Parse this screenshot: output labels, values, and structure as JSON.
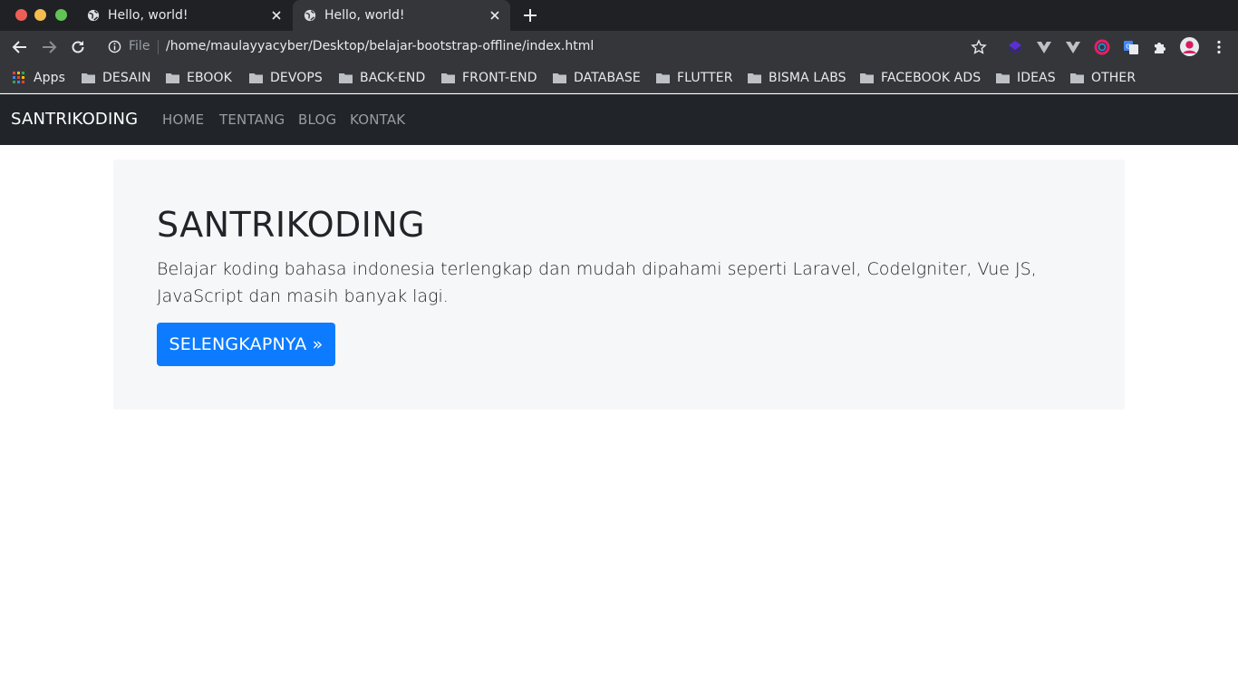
{
  "browser": {
    "tabs": [
      {
        "title": "Hello, world!",
        "active": false
      },
      {
        "title": "Hello, world!",
        "active": true
      }
    ],
    "address": {
      "scheme_label": "File",
      "url": "/home/maulayyacyber/Desktop/belajar-bootstrap-offline/index.html"
    },
    "bookmarks": [
      {
        "label": "Apps",
        "icon": "apps-grid-icon"
      },
      {
        "label": "DESAIN",
        "icon": "folder-icon"
      },
      {
        "label": "EBOOK",
        "icon": "folder-icon"
      },
      {
        "label": "DEVOPS",
        "icon": "folder-icon"
      },
      {
        "label": "BACK-END",
        "icon": "folder-icon"
      },
      {
        "label": "FRONT-END",
        "icon": "folder-icon"
      },
      {
        "label": "DATABASE",
        "icon": "folder-icon"
      },
      {
        "label": "FLUTTER",
        "icon": "folder-icon"
      },
      {
        "label": "BISMA LABS",
        "icon": "folder-icon"
      },
      {
        "label": "FACEBOOK ADS",
        "icon": "folder-icon"
      },
      {
        "label": "IDEAS",
        "icon": "folder-icon"
      },
      {
        "label": "OTHER",
        "icon": "folder-icon"
      }
    ],
    "colors": {
      "titlebar": "#202124",
      "toolbar": "#35363a",
      "text": "#e8eaed"
    }
  },
  "page": {
    "navbar": {
      "brand": "SANTRIKODING",
      "links": [
        "HOME",
        "TENTANG",
        "BLOG",
        "KONTAK"
      ]
    },
    "jumbotron": {
      "title": "SANTRIKODING",
      "lead": "Belajar koding bahasa indonesia terlengkap dan mudah dipahami seperti Laravel, CodeIgniter, Vue JS, JavaScript dan masih banyak lagi.",
      "button_label": "SELENGKAPNYA »"
    },
    "colors": {
      "navbar_bg": "#212529",
      "jumbotron_bg": "#f6f7f9",
      "primary": "#0d7bff"
    }
  }
}
